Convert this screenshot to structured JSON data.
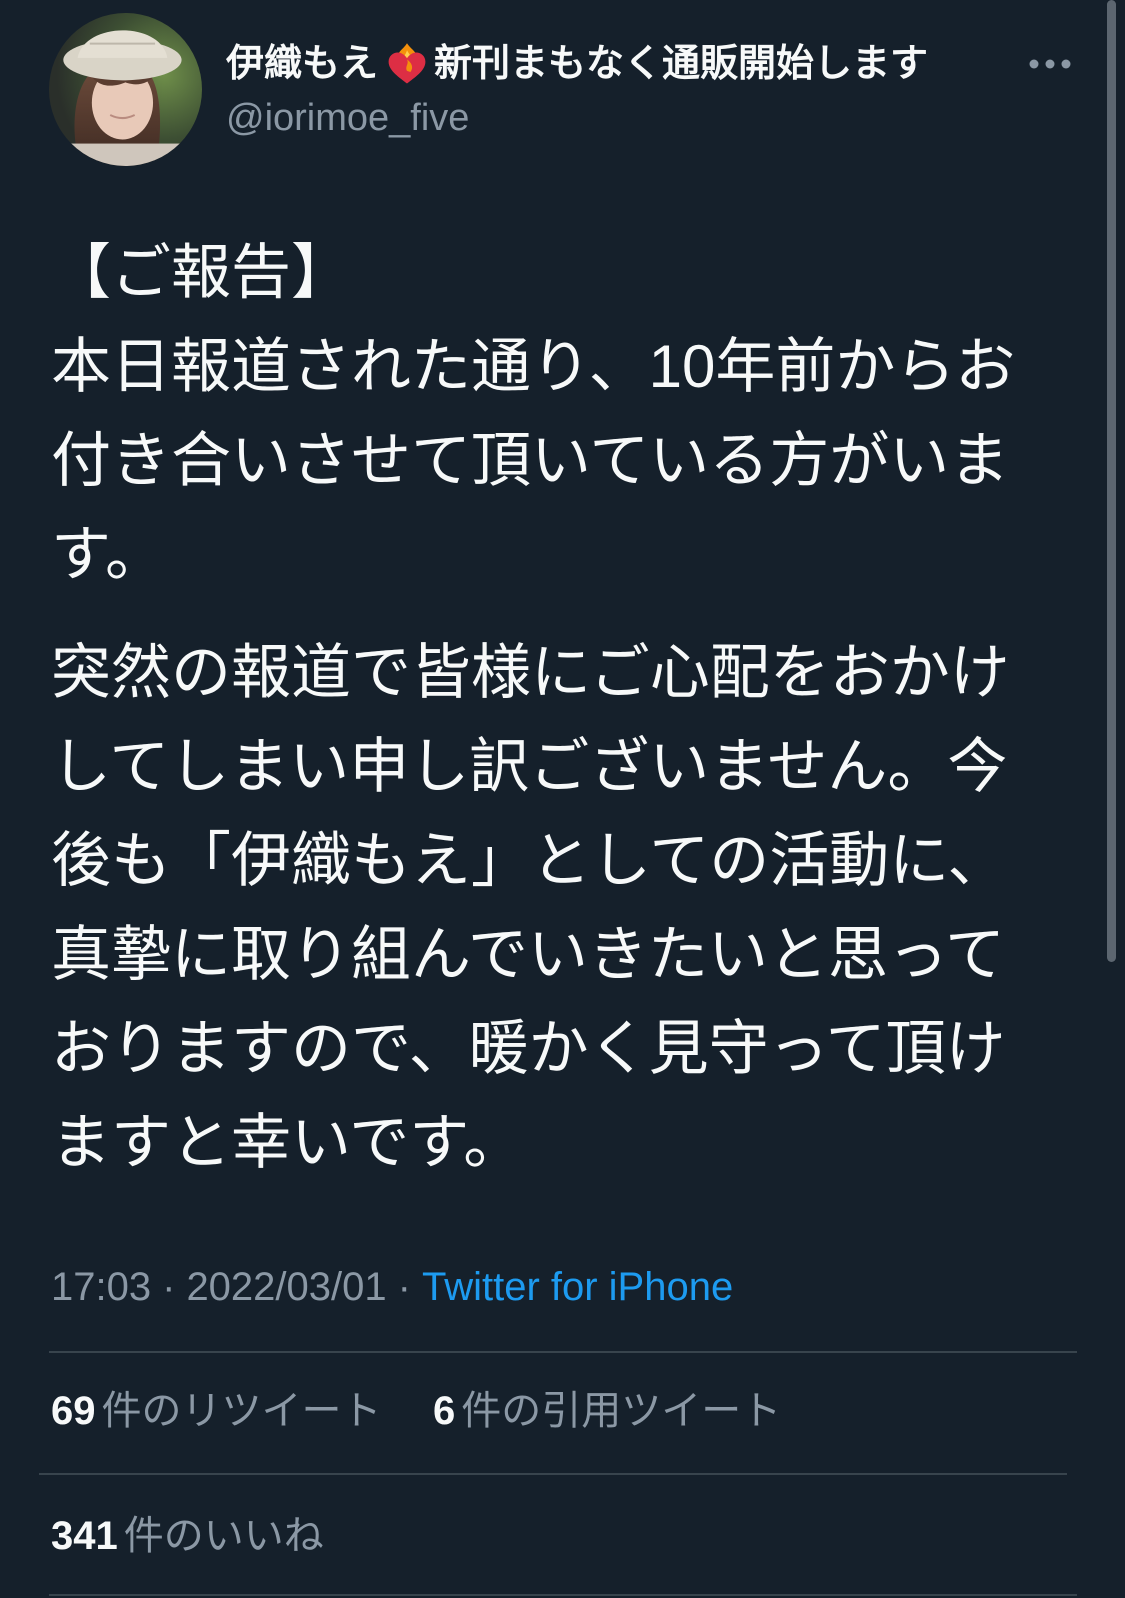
{
  "colors": {
    "background": "#15202b",
    "text": "#f7f9f9",
    "muted": "#8b98a5",
    "link": "#1d9bf0",
    "divider": "#38444d",
    "scrollbar": "#5c6670"
  },
  "author": {
    "avatar_icon": "avatar-photo",
    "name_before_emoji": "伊織もえ",
    "name_emoji_icon": "heart-on-fire-icon",
    "name_after_emoji": "新刊まもなく通販開始します",
    "handle": "@iorimoe_five",
    "more_icon": "more-dots-icon"
  },
  "tweet": {
    "paragraphs": [
      {
        "lines": [
          "【ご報告】",
          "本日報道された通り、10年前からお",
          "付き合いさせて頂いている方がいま",
          "す。"
        ]
      },
      {
        "lines": [
          "突然の報道で皆様にご心配をおかけ",
          "してしまい申し訳ございません。今",
          "後も「伊織もえ」としての活動に、",
          "真摯に取り組んでいきたいと思って",
          "おりますので、暖かく見守って頂け",
          "ますと幸いです。"
        ]
      }
    ]
  },
  "meta": {
    "time": "17:03",
    "separator": "·",
    "date": "2022/03/01",
    "source": "Twitter for iPhone"
  },
  "stats": [
    {
      "count": "69",
      "label": "件のリツイート"
    },
    {
      "count": "6",
      "label": "件の引用ツイート"
    }
  ],
  "likes": {
    "count": "341",
    "label": "件のいいね"
  }
}
